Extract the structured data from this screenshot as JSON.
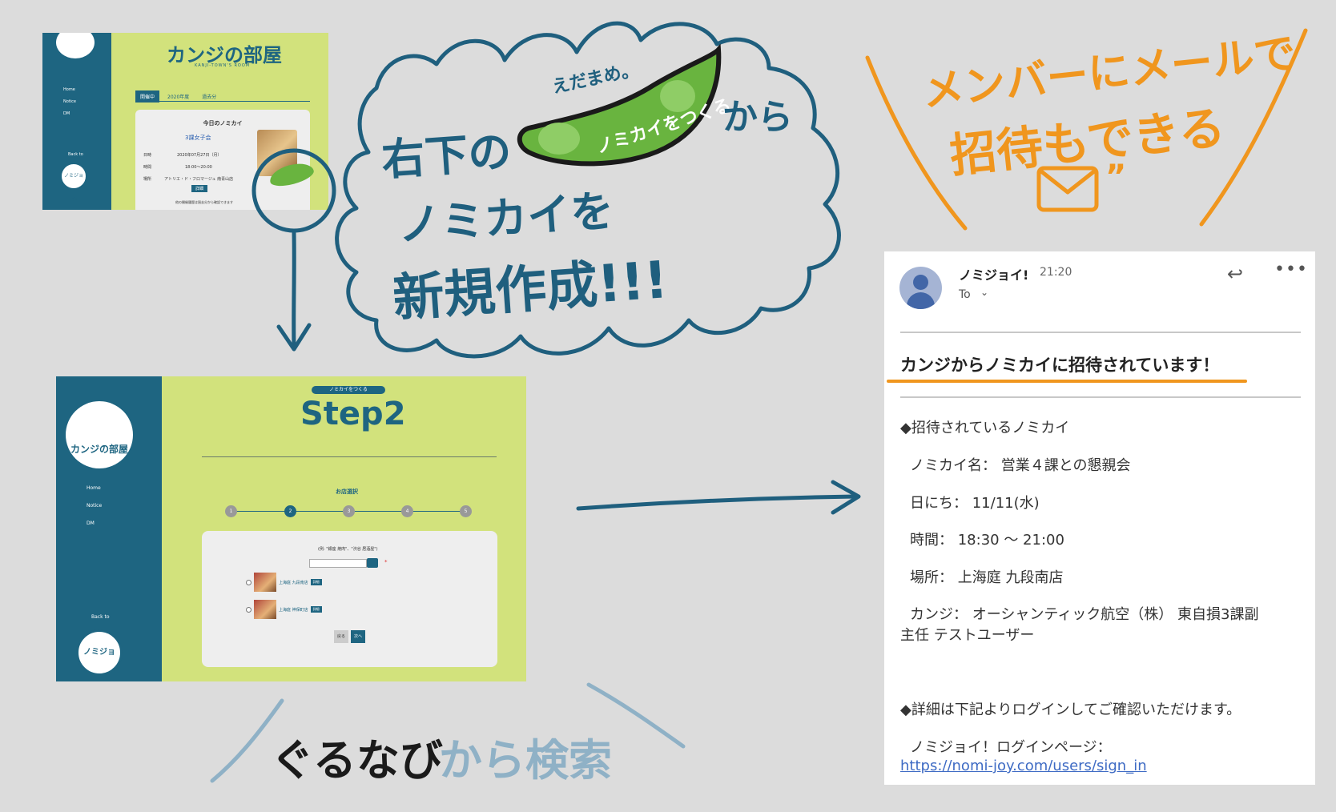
{
  "annotations": {
    "edamame_label": "えだまめ。",
    "edamame_button": "ノミカイをつくる",
    "from": "から",
    "bubble_line1": "右下の",
    "bubble_line2": "ノミカイを",
    "bubble_line3": "新規作成!!!",
    "mail_note_line1": "メンバーにメールで",
    "mail_note_line2": "招待もできる",
    "gurunavi": "ぐるなび",
    "gurunavi_search": "から検索"
  },
  "screen1": {
    "app_title": "カンジの部屋",
    "app_subtitle": "KANJI-TOWN'S ROOM",
    "nav": [
      "Home",
      "Notice",
      "DM"
    ],
    "back_label": "Back to",
    "beer_logo": "ノミジョイ!",
    "tabs": [
      "開催中",
      "2020年度",
      "過去分"
    ],
    "card_title": "今日のノミカイ",
    "event_name": "3課女子会",
    "rows": [
      {
        "label": "日時",
        "value": "2020年07月27日（月）"
      },
      {
        "label": "時間",
        "value": "18:00〜20:00"
      },
      {
        "label": "場所",
        "value": "アトリエ・ド・フロマージュ 南青山店"
      }
    ],
    "detail_button": "詳細",
    "footer": "他の開催履歴は過去分から確認できます"
  },
  "screen2": {
    "app_title": "カンジの部屋",
    "nav": [
      "Home",
      "Notice",
      "DM"
    ],
    "back_label": "Back to",
    "beer_logo": "ノミジョイ!",
    "pill": "ノミカイをつくる",
    "step": "Step2",
    "section": "お店選択",
    "steps": [
      "1",
      "2",
      "3",
      "4",
      "5"
    ],
    "current_step": 2,
    "hint": "(例: \"銀座 焼肉\"、\"渋谷 居酒屋\")",
    "shops": [
      {
        "name": "上海庭 九段南店",
        "tag": "詳細"
      },
      {
        "name": "上海庭 神保町店",
        "tag": "詳細"
      }
    ],
    "back_button": "戻る",
    "next_button": "次へ"
  },
  "email": {
    "sender": "ノミジョイ!",
    "time": "21:20",
    "to_label": "To",
    "subject": "カンジからノミカイに招待されています！",
    "lines": [
      "◆招待されているノミカイ",
      "ノミカイ名： 営業４課との懇親会",
      "日にち： 11/11(水)",
      "時間： 18:30 ～ 21:00",
      "場所： 上海庭 九段南店",
      "カンジ： オーシャンティック航空（株） 東自損3課副",
      "主任  テストユーザー",
      "◆詳細は下記よりログインしてご確認いただけます。",
      "ノミジョイ！ログインページ："
    ],
    "link": "https://nomi-joy.com/users/sign_in"
  },
  "colors": {
    "background": "#dcdcdc",
    "navy": "#1e6581",
    "lime": "#d2e27c",
    "ink_blue": "#1f5f7e",
    "orange": "#f0961e",
    "edamame": "#69b43f"
  }
}
